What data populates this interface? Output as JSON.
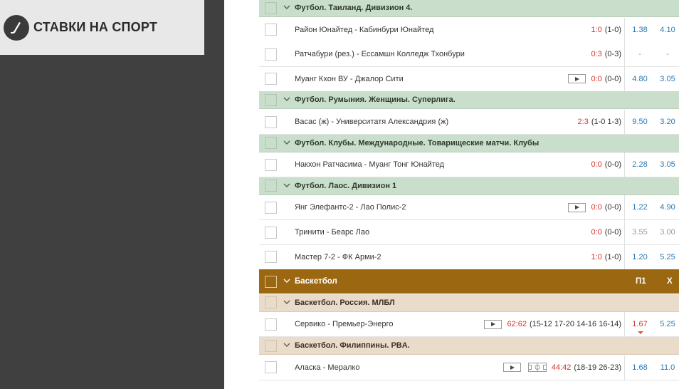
{
  "brand": {
    "title": "СТАВКИ НА СПОРТ",
    "icon": "hockey-stick-icon"
  },
  "colors": {
    "league_bg": "#c9dfcc",
    "basket_league_bg": "#eadccb",
    "sport_header_bg": "#9b6711",
    "live_score": "#d9332f",
    "odds": "#2a7ab3",
    "sidebar": "#404040"
  },
  "rows": [
    {
      "kind": "league",
      "title": "Футбол. Таиланд. Дивизион 4."
    },
    {
      "kind": "match",
      "name": "Район Юнайтед - Кабинбури Юнайтед",
      "live": "1:0",
      "detail": "(1-0)",
      "odd1": "1.38",
      "odd2": "4.10"
    },
    {
      "kind": "match",
      "name": "Ратчабури (рез.) - Ессамшн Колледж Тхонбури",
      "live": "0:3",
      "detail": "(0-3)",
      "odd1": "-",
      "odd2": "-"
    },
    {
      "kind": "match",
      "name": "Муанг Кхон ВУ - Джалор Сити",
      "live": "0:0",
      "detail": "(0-0)",
      "odd1": "4.80",
      "odd2": "3.05",
      "video": true
    },
    {
      "kind": "league",
      "title": "Футбол. Румыния. Женщины. Суперлига."
    },
    {
      "kind": "match",
      "name": "Васас (ж) - Университатя Александрия (ж)",
      "live": "2:3",
      "detail": "(1-0 1-3)",
      "odd1": "9.50",
      "odd2": "3.20"
    },
    {
      "kind": "league",
      "title": "Футбол. Клубы. Международные. Товарищеские матчи. Клубы"
    },
    {
      "kind": "match",
      "name": "Накхон Ратчасима - Муанг Тонг Юнайтед",
      "live": "0:0",
      "detail": "(0-0)",
      "odd1": "2.28",
      "odd2": "3.05"
    },
    {
      "kind": "league",
      "title": "Футбол. Лаос. Дивизион 1"
    },
    {
      "kind": "match",
      "name": "Янг Элефантс-2 - Лао Полис-2",
      "live": "0:0",
      "detail": "(0-0)",
      "odd1": "1.22",
      "odd2": "4.90",
      "video": true
    },
    {
      "kind": "match",
      "name": "Тринити - Беарс Лао",
      "live": "0:0",
      "detail": "(0-0)",
      "odd1": "3.55",
      "odd2": "3.00",
      "greyOdds": true
    },
    {
      "kind": "match",
      "name": "Мастер 7-2 - ФК Арми-2",
      "live": "1:0",
      "detail": "(1-0)",
      "odd1": "1.20",
      "odd2": "5.25"
    },
    {
      "kind": "sport",
      "title": "Баскетбол",
      "col1": "П1",
      "col2": "Х"
    },
    {
      "kind": "league",
      "title": "Баскетбол. Россия. МЛБЛ",
      "bb": true
    },
    {
      "kind": "match",
      "name": "Сервико - Премьер-Энерго",
      "live": "62:62",
      "detail": "(15-12 17-20 14-16 16-14)",
      "odd1": "1.67",
      "odd2": "5.25",
      "video": true,
      "redOdd1": true,
      "tick": true
    },
    {
      "kind": "league",
      "title": "Баскетбол. Филиппины. PBA.",
      "bb": true
    },
    {
      "kind": "match",
      "name": "Аласка - Мералко",
      "live": "44:42",
      "detail": "(18-19 26-23)",
      "odd1": "1.68",
      "odd2": "11.0",
      "video": true,
      "field": true
    }
  ]
}
